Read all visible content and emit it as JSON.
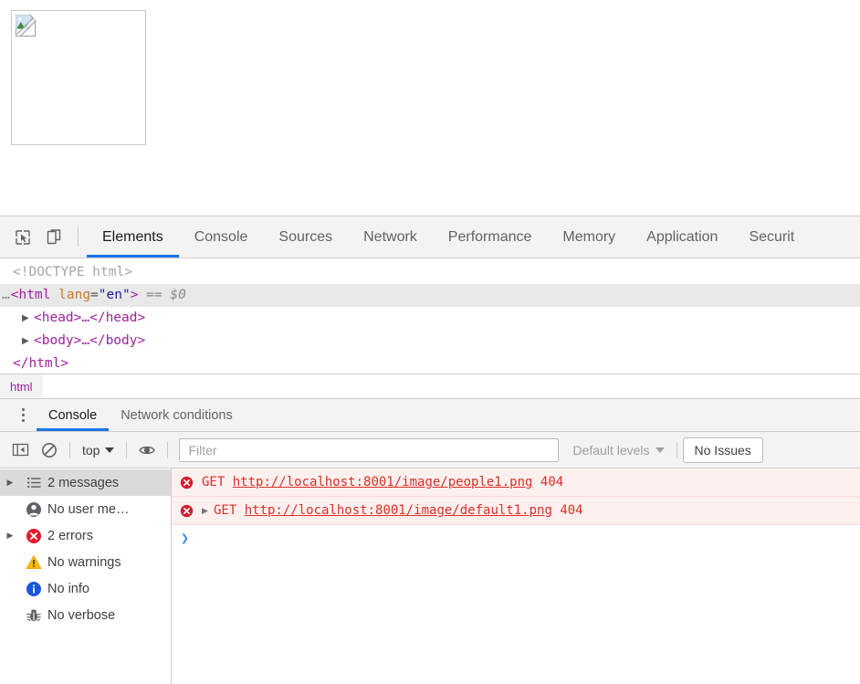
{
  "page": {
    "broken_image_alt": "broken-image-placeholder"
  },
  "devtools": {
    "main_tabs": [
      {
        "label": "Elements",
        "active": true
      },
      {
        "label": "Console",
        "active": false
      },
      {
        "label": "Sources",
        "active": false
      },
      {
        "label": "Network",
        "active": false
      },
      {
        "label": "Performance",
        "active": false
      },
      {
        "label": "Memory",
        "active": false
      },
      {
        "label": "Application",
        "active": false
      },
      {
        "label": "Securit",
        "active": false
      }
    ],
    "toolbar_icons": {
      "inspect": "inspect-element-icon",
      "device": "device-toolbar-icon"
    },
    "dom_tree": {
      "doctype": "<!DOCTYPE html>",
      "html_open_ellipsis": "…",
      "html_tag_open": "<html",
      "html_attr_name": "lang",
      "html_attr_eq": "=",
      "html_attr_value": "\"en\"",
      "html_tag_close": ">",
      "selected_marker": "== $0",
      "head_row": "<head>…</head>",
      "body_row": "<body>…</body>",
      "html_close": "</html>"
    },
    "breadcrumb": {
      "items": [
        "html"
      ]
    },
    "drawer_tabs": [
      {
        "label": "Console",
        "active": true
      },
      {
        "label": "Network conditions",
        "active": false
      }
    ],
    "console_toolbar": {
      "sidebar_toggle_icon": "console-sidebar-toggle-icon",
      "clear_icon": "clear-console-icon",
      "context_selector": "top",
      "eye_icon": "live-expression-eye-icon",
      "filter_placeholder": "Filter",
      "filter_value": "",
      "levels_selector": "Default levels",
      "issues_button": "No Issues"
    },
    "console_sidebar": [
      {
        "label": "2 messages",
        "icon": "list-icon",
        "selected": true,
        "expandable": true
      },
      {
        "label": "No user me…",
        "icon": "user-icon",
        "selected": false,
        "expandable": false
      },
      {
        "label": "2 errors",
        "icon": "error-icon",
        "selected": false,
        "expandable": true
      },
      {
        "label": "No warnings",
        "icon": "warning-icon",
        "selected": false,
        "expandable": false
      },
      {
        "label": "No info",
        "icon": "info-icon",
        "selected": false,
        "expandable": false
      },
      {
        "label": "No verbose",
        "icon": "bug-icon",
        "selected": false,
        "expandable": false
      }
    ],
    "console_messages": [
      {
        "level": "error",
        "expandable": false,
        "method": "GET",
        "url": "http://localhost:8001/image/people1.png",
        "status": "404"
      },
      {
        "level": "error",
        "expandable": true,
        "method": "GET",
        "url": "http://localhost:8001/image/default1.png",
        "status": "404"
      }
    ],
    "prompt": {
      "chevron": "›",
      "value": ""
    }
  },
  "colors": {
    "accent": "#1a73e8",
    "error": "#d93025",
    "error_bg": "#fff0f0",
    "toolbar_bg": "#f3f3f3",
    "tag": "#a020a0",
    "attr": "#c77b2d",
    "value": "#1a1aa6"
  }
}
